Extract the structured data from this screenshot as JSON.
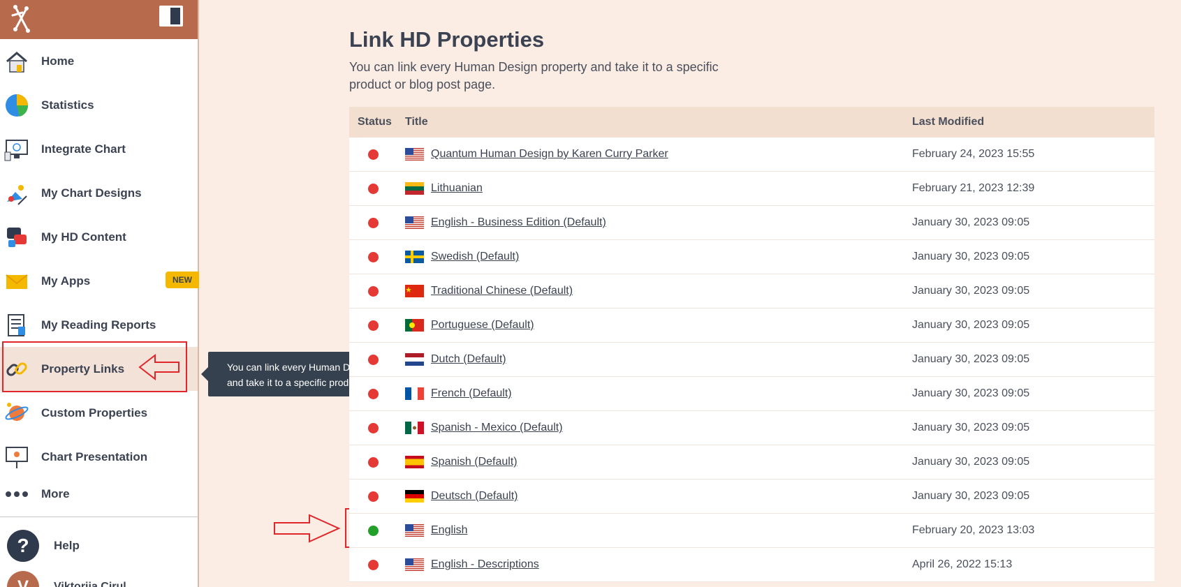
{
  "sidebar": {
    "items": [
      {
        "label": "Home",
        "icon": "home-icon"
      },
      {
        "label": "Statistics",
        "icon": "pie-chart-icon"
      },
      {
        "label": "Integrate Chart",
        "icon": "monitor-chart-icon"
      },
      {
        "label": "My Chart Designs",
        "icon": "design-palette-icon"
      },
      {
        "label": "My HD Content",
        "icon": "content-chat-icon"
      },
      {
        "label": "My Apps",
        "icon": "envelope-icon",
        "badge": "NEW"
      },
      {
        "label": "My Reading Reports",
        "icon": "report-document-icon"
      },
      {
        "label": "Property Links",
        "icon": "chain-link-icon"
      },
      {
        "label": "Custom Properties",
        "icon": "planet-icon"
      },
      {
        "label": "Chart Presentation",
        "icon": "presentation-board-icon"
      },
      {
        "label": "More",
        "icon": "more-dots-icon"
      }
    ],
    "help_label": "Help",
    "help_glyph": "?",
    "avatar_initial": "V",
    "user_name": "Viktorija Cirul"
  },
  "tooltip": {
    "line1": "You can link every Human Design property",
    "line2": "and take it to a specific product or blog post page."
  },
  "main": {
    "title": "Link HD Properties",
    "description": "You can link every Human Design property and take it to a specific product or blog post page.",
    "columns": {
      "status": "Status",
      "title": "Title",
      "modified": "Last Modified"
    },
    "rows": [
      {
        "title": "Quantum Human Design by Karen Curry Parker",
        "date": "February 24, 2023 15:55",
        "flag": "us",
        "status": "red"
      },
      {
        "title": "Lithuanian",
        "date": "February 21, 2023 12:39",
        "flag": "lt",
        "status": "red"
      },
      {
        "title": "English - Business Edition (Default)",
        "date": "January 30, 2023 09:05",
        "flag": "us",
        "status": "red"
      },
      {
        "title": "Swedish (Default)",
        "date": "January 30, 2023 09:05",
        "flag": "se",
        "status": "red"
      },
      {
        "title": "Traditional Chinese (Default)",
        "date": "January 30, 2023 09:05",
        "flag": "cn",
        "status": "red"
      },
      {
        "title": "Portuguese (Default)",
        "date": "January 30, 2023 09:05",
        "flag": "pt",
        "status": "red"
      },
      {
        "title": "Dutch (Default)",
        "date": "January 30, 2023 09:05",
        "flag": "nl",
        "status": "red"
      },
      {
        "title": "French (Default)",
        "date": "January 30, 2023 09:05",
        "flag": "fr",
        "status": "red"
      },
      {
        "title": "Spanish - Mexico (Default)",
        "date": "January 30, 2023 09:05",
        "flag": "mx",
        "status": "red"
      },
      {
        "title": "Spanish (Default)",
        "date": "January 30, 2023 09:05",
        "flag": "es",
        "status": "red"
      },
      {
        "title": "Deutsch (Default)",
        "date": "January 30, 2023 09:05",
        "flag": "de",
        "status": "red"
      },
      {
        "title": "English",
        "date": "February 20, 2023 13:03",
        "flag": "us",
        "status": "green"
      },
      {
        "title": "English - Descriptions",
        "date": "April 26, 2022 15:13",
        "flag": "us",
        "status": "red"
      }
    ]
  },
  "colors": {
    "status_red": "#e53935",
    "status_green": "#22a02a",
    "brand": "#b86a4c",
    "annotation": "#e0262a"
  }
}
